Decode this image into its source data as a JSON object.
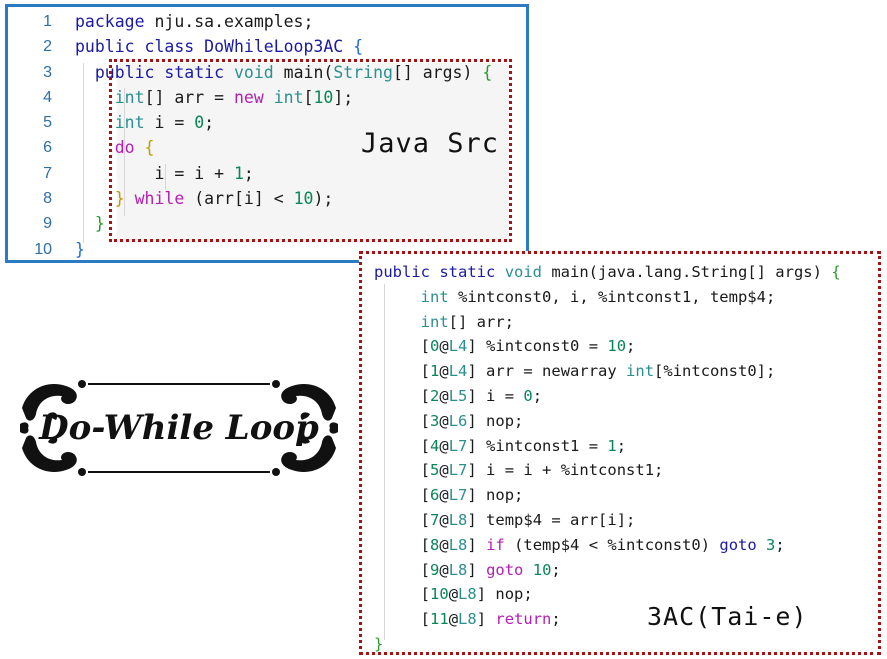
{
  "java_src": {
    "line_numbers": [
      "1",
      "2",
      "3",
      "4",
      "5",
      "6",
      "7",
      "8",
      "9",
      "10"
    ],
    "line1": {
      "a": "package",
      "b": " nju.sa.examples;"
    },
    "line2": {
      "a": "public",
      "b": " ",
      "c": "class",
      "d": " DoWhileLoop3AC ",
      "e": "{"
    },
    "line3": {
      "a": "public",
      "b": " ",
      "c": "static",
      "d": " ",
      "e": "void",
      "f": " main(",
      "g": "String",
      "h": "[] args)",
      "i": " {"
    },
    "line4": {
      "a": "int",
      "b": "[] arr = ",
      "c": "new",
      "d": " ",
      "e": "int",
      "f": "[",
      "g": "10",
      "h": "];"
    },
    "line5": {
      "a": "int",
      "b": " i = ",
      "c": "0",
      "d": ";"
    },
    "line6": {
      "a": "do",
      "b": " {"
    },
    "line7": {
      "a": "i = i + ",
      "b": "1",
      "c": ";"
    },
    "line8": {
      "a": "}",
      "b": " ",
      "c": "while",
      "d": " (arr[i] < ",
      "e": "10",
      "f": ");"
    },
    "line9": {
      "a": "}"
    },
    "line10": {
      "a": "}"
    },
    "label": "Java Src"
  },
  "tac": {
    "header": {
      "a": "public",
      "b": " ",
      "c": "static",
      "d": " ",
      "e": "void",
      "f": " main(java.lang.String[] args) ",
      "g": "{"
    },
    "decl1": {
      "a": "int",
      "b": " %intconst0, i, %intconst1, temp$4;"
    },
    "decl2": {
      "a": "int",
      "b": "[] arr;"
    },
    "stmts": [
      {
        "idx": "0",
        "line": "L4",
        "text": " %intconst0 = ",
        "num": "10",
        "tail": ";"
      },
      {
        "idx": "1",
        "line": "L4",
        "text": " arr = newarray ",
        "kw": "int",
        "text2": "[%intconst0];"
      },
      {
        "idx": "2",
        "line": "L5",
        "text": " i = ",
        "num": "0",
        "tail": ";"
      },
      {
        "idx": "3",
        "line": "L6",
        "text": " nop;"
      },
      {
        "idx": "4",
        "line": "L7",
        "text": " %intconst1 = ",
        "num": "1",
        "tail": ";"
      },
      {
        "idx": "5",
        "line": "L7",
        "text": " i = i + %intconst1;"
      },
      {
        "idx": "6",
        "line": "L7",
        "text": " nop;"
      },
      {
        "idx": "7",
        "line": "L8",
        "text": " temp$4 = arr[i];"
      },
      {
        "idx": "8",
        "line": "L8",
        "kwp": "if",
        "text": " (temp$4 < %intconst0) ",
        "kwb": "goto",
        "num": "3",
        "tail": ";"
      },
      {
        "idx": "9",
        "line": "L8",
        "kwp": "goto",
        "num": "10",
        "tail": ";"
      },
      {
        "idx": "10",
        "line": "L8",
        "text": " nop;"
      },
      {
        "idx": "11",
        "line": "L8",
        "kwp": "return",
        "tail": ";"
      }
    ],
    "close": "}",
    "label": "3AC(Tai-e)"
  },
  "ornament": {
    "title": "Do-While Loop"
  },
  "colors": {
    "panel_border": "#2b7bc4",
    "dotted_border": "#a51414",
    "keyword_blue": "#1a1aa6",
    "keyword_purple": "#b420b4",
    "type_teal": "#2b8f8f",
    "number_green": "#098658"
  }
}
